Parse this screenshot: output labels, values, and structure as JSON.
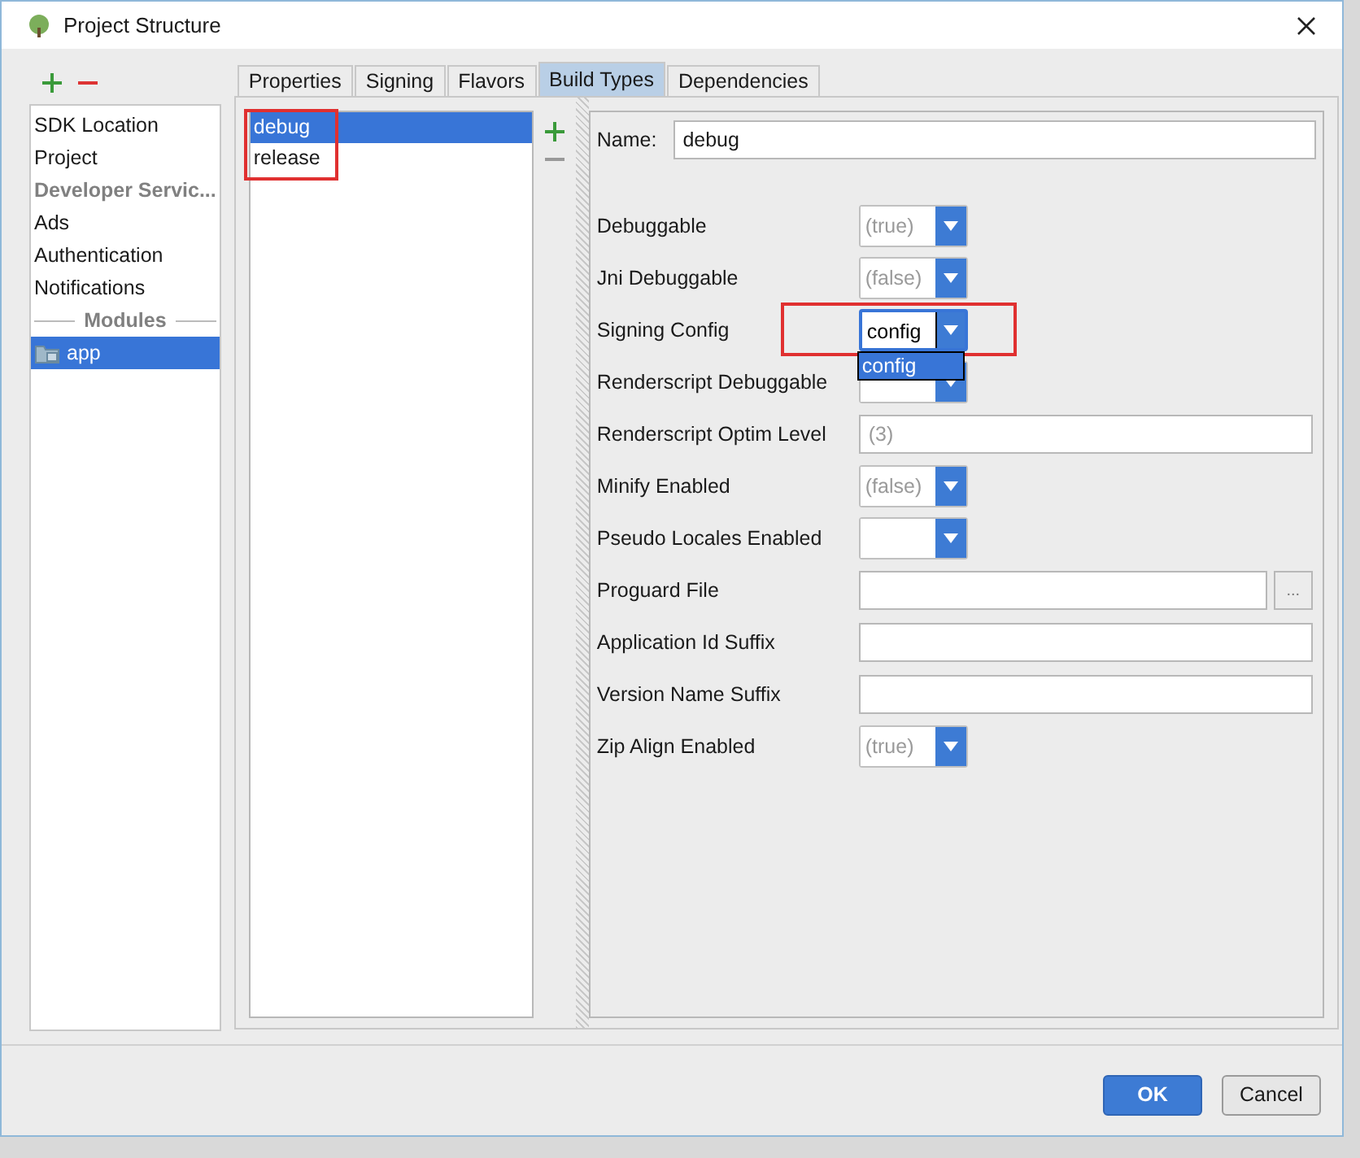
{
  "window": {
    "title": "Project Structure"
  },
  "sidebar": {
    "items": [
      {
        "kind": "item",
        "label": "SDK Location",
        "selected": false
      },
      {
        "kind": "item",
        "label": "Project",
        "selected": false
      },
      {
        "kind": "header",
        "label": "Developer Servic..."
      },
      {
        "kind": "item",
        "label": "Ads",
        "selected": false
      },
      {
        "kind": "item",
        "label": "Authentication",
        "selected": false
      },
      {
        "kind": "item",
        "label": "Notifications",
        "selected": false
      },
      {
        "kind": "separator",
        "label": "Modules"
      },
      {
        "kind": "module",
        "label": "app",
        "selected": true
      }
    ]
  },
  "tabs": [
    {
      "label": "Properties",
      "selected": false
    },
    {
      "label": "Signing",
      "selected": false
    },
    {
      "label": "Flavors",
      "selected": false
    },
    {
      "label": "Build Types",
      "selected": true
    },
    {
      "label": "Dependencies",
      "selected": false
    }
  ],
  "build_types": {
    "highlighted": true,
    "items": [
      {
        "label": "debug",
        "selected": true
      },
      {
        "label": "release",
        "selected": false
      }
    ]
  },
  "name_field": {
    "label": "Name:",
    "value": "debug"
  },
  "rows": [
    {
      "kind": "combo",
      "label": "Debuggable",
      "placeholder": "(true)",
      "highlighted": false
    },
    {
      "kind": "combo",
      "label": "Jni Debuggable",
      "placeholder": "(false)",
      "highlighted": false
    },
    {
      "kind": "combo",
      "label": "Signing Config",
      "value": "config",
      "focused": true,
      "highlighted": true,
      "options": [
        {
          "label": "config",
          "selected": true
        }
      ]
    },
    {
      "kind": "combo",
      "label": "Renderscript Debuggable",
      "highlighted": false
    },
    {
      "kind": "text",
      "label": "Renderscript Optim Level",
      "placeholder": "(3)",
      "highlighted": false
    },
    {
      "kind": "combo",
      "label": "Minify Enabled",
      "placeholder": "(false)",
      "highlighted": false
    },
    {
      "kind": "combo",
      "label": "Pseudo Locales Enabled",
      "highlighted": false
    },
    {
      "kind": "file",
      "label": "Proguard File",
      "button": "...",
      "highlighted": false
    },
    {
      "kind": "text",
      "label": "Application Id Suffix",
      "highlighted": false
    },
    {
      "kind": "text",
      "label": "Version Name Suffix",
      "highlighted": false
    },
    {
      "kind": "combo",
      "label": "Zip Align Enabled",
      "placeholder": "(true)",
      "highlighted": false
    }
  ],
  "buttons": [
    {
      "label": "OK",
      "kind": "primary"
    },
    {
      "label": "Cancel",
      "kind": "secondary"
    }
  ]
}
